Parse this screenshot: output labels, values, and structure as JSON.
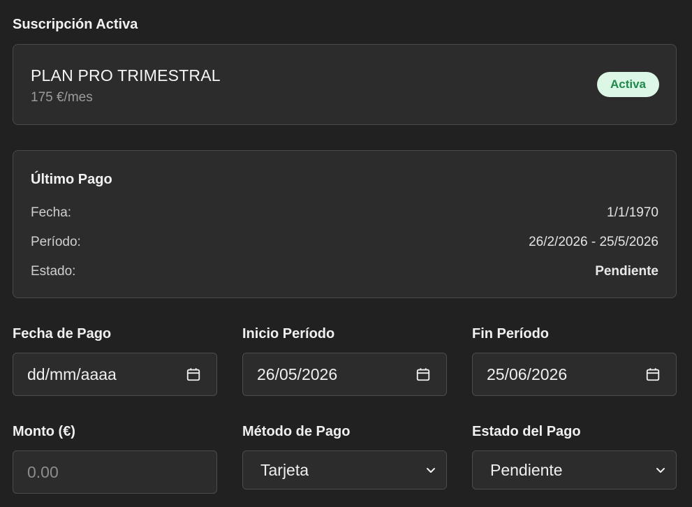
{
  "subscription": {
    "section_title": "Suscripción Activa",
    "plan_name": "PLAN PRO TRIMESTRAL",
    "price": "175 €/mes",
    "status_badge": "Activa",
    "badge_bg": "#dcf7e5",
    "badge_color": "#1f8a4c"
  },
  "last_payment": {
    "title": "Último Pago",
    "rows": [
      {
        "label": "Fecha:",
        "value": "1/1/1970"
      },
      {
        "label": "Período:",
        "value": "26/2/2026 - 25/5/2026"
      },
      {
        "label": "Estado:",
        "value": "Pendiente"
      }
    ]
  },
  "form": {
    "payment_date": {
      "label": "Fecha de Pago",
      "value": "dd/mm/aaaa",
      "icon": "calendar-icon"
    },
    "period_start": {
      "label": "Inicio Período",
      "value": "26/05/2026",
      "icon": "calendar-icon"
    },
    "period_end": {
      "label": "Fin Período",
      "value": "25/06/2026",
      "icon": "calendar-icon"
    },
    "amount": {
      "label": "Monto (€)",
      "placeholder": "0.00"
    },
    "payment_method": {
      "label": "Método de Pago",
      "selected": "Tarjeta",
      "icon": "chevron-down-icon"
    },
    "payment_status": {
      "label": "Estado del Pago",
      "selected": "Pendiente",
      "icon": "chevron-down-icon"
    }
  }
}
